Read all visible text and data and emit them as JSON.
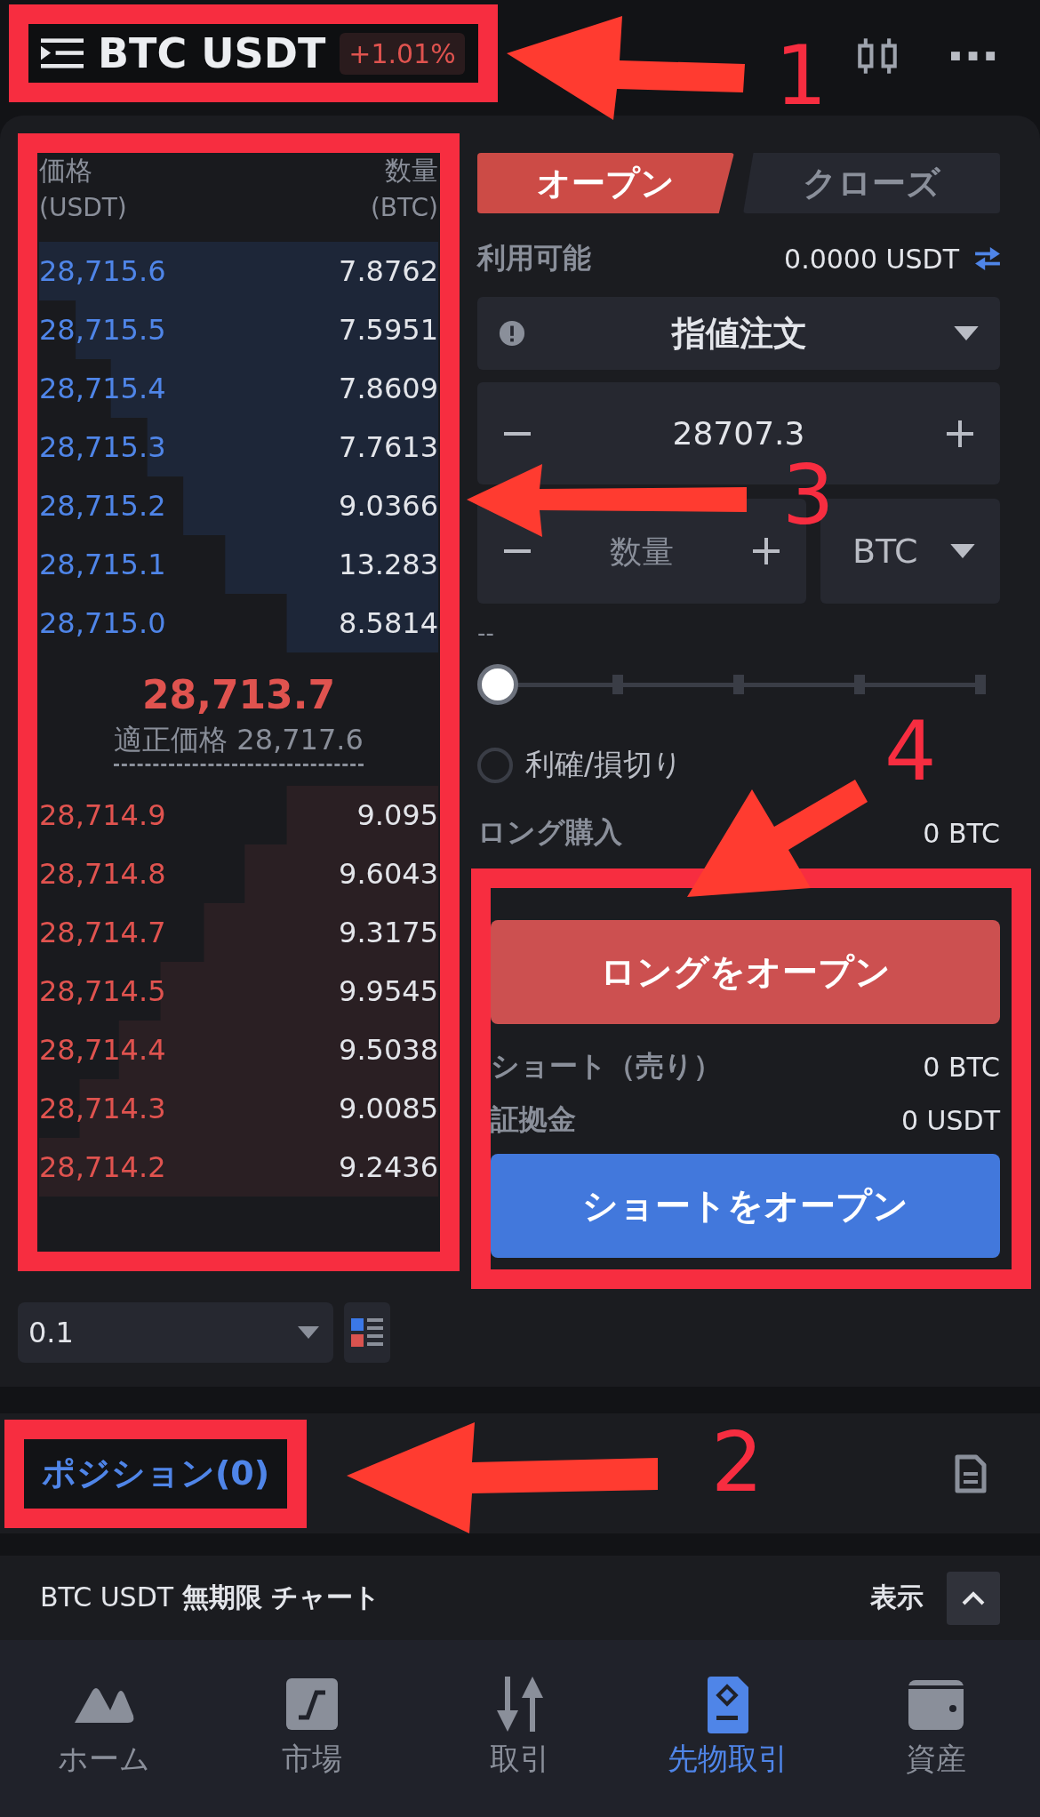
{
  "header": {
    "title": "BTC USDT",
    "change": "+1.01%"
  },
  "order_book": {
    "price_label": "価格",
    "price_unit": "(USDT)",
    "qty_label": "数量",
    "qty_unit": "(BTC)",
    "asks": [
      {
        "price": "28,715.6",
        "qty": "7.8762"
      },
      {
        "price": "28,715.5",
        "qty": "7.5951"
      },
      {
        "price": "28,715.4",
        "qty": "7.8609"
      },
      {
        "price": "28,715.3",
        "qty": "7.7613"
      },
      {
        "price": "28,715.2",
        "qty": "9.0366"
      },
      {
        "price": "28,715.1",
        "qty": "13.283"
      },
      {
        "price": "28,715.0",
        "qty": "8.5814"
      }
    ],
    "last_price": "28,713.7",
    "fair_price_label": "適正価格",
    "fair_price": "28,717.6",
    "bids": [
      {
        "price": "28,714.9",
        "qty": "9.095"
      },
      {
        "price": "28,714.8",
        "qty": "9.6043"
      },
      {
        "price": "28,714.7",
        "qty": "9.3175"
      },
      {
        "price": "28,714.5",
        "qty": "9.9545"
      },
      {
        "price": "28,714.4",
        "qty": "9.5038"
      },
      {
        "price": "28,714.3",
        "qty": "9.0085"
      },
      {
        "price": "28,714.2",
        "qty": "9.2436"
      }
    ],
    "precision": "0.1"
  },
  "trade": {
    "tabs": [
      {
        "label": "オープン",
        "selected": true
      },
      {
        "label": "クローズ",
        "selected": false
      }
    ],
    "available_label": "利用可能",
    "available": "0.0000 USDT",
    "order_type": "指値注文",
    "price": "28707.3",
    "qty_placeholder": "数量",
    "unit": "BTC",
    "amount_note": "--",
    "slider": {
      "level": 0
    },
    "tpsl": {
      "label": "利確/損切り",
      "checked": false
    },
    "long_label": "ロング購入",
    "long_value": "0 BTC",
    "long_button": "ロングをオープン",
    "short_label": "ショート（売り）",
    "short_value": "0 BTC",
    "margin_label": "証拠金",
    "margin_value": "0 USDT",
    "short_button": "ショートをオープン"
  },
  "position_tabs": [
    {
      "label": "ポジション(0)",
      "selected": true
    }
  ],
  "chart_bar": {
    "title": "BTC USDT **無期限 チャート**",
    "toggle": "表示"
  },
  "nav": [
    {
      "label": "ホーム",
      "selected": false
    },
    {
      "label": "市場",
      "selected": false
    },
    {
      "label": "取引",
      "selected": false
    },
    {
      "label": "先物取引",
      "selected": true
    },
    {
      "label": "資産",
      "selected": false
    }
  ],
  "annotations": [
    "1",
    "2",
    "3",
    "4"
  ]
}
